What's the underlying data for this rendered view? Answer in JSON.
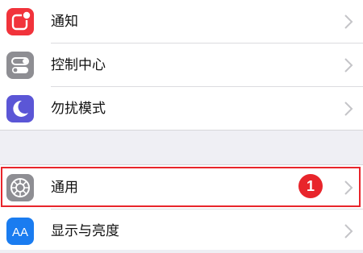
{
  "settings": {
    "group1": [
      {
        "label": "通知",
        "icon": "notifications-icon",
        "color": "#f1333b"
      },
      {
        "label": "控制中心",
        "icon": "control-center-icon",
        "color": "#8e8e93"
      },
      {
        "label": "勿扰模式",
        "icon": "moon-icon",
        "color": "#5b56d6"
      }
    ],
    "group2": [
      {
        "label": "通用",
        "icon": "gear-icon",
        "color": "#8e8e93"
      },
      {
        "label": "显示与亮度",
        "icon": "display-icon",
        "color": "#1a7cf0",
        "icon_text": "AA"
      }
    ]
  },
  "annotation": {
    "step_number": "1",
    "highlight_color": "#e8252b"
  }
}
